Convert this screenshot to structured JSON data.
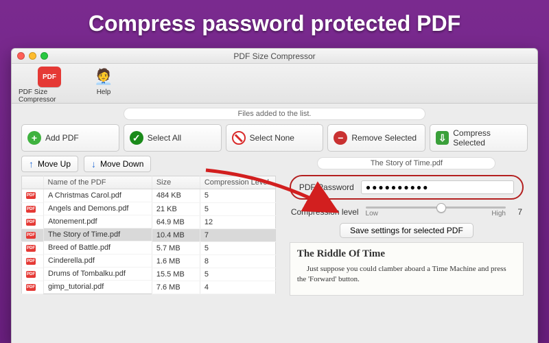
{
  "banner": "Compress password protected PDF",
  "window_title": "PDF Size Compressor",
  "toolbar": {
    "app_label": "PDF Size Compressor",
    "help_label": "Help",
    "badge": "PDF"
  },
  "status": "Files added to the list.",
  "actions": {
    "add": "Add PDF",
    "select_all": "Select All",
    "select_none": "Select None",
    "remove": "Remove Selected",
    "compress": "Compress Selected"
  },
  "move": {
    "up": "Move Up",
    "down": "Move Down"
  },
  "columns": {
    "name": "Name of the PDF",
    "size": "Size",
    "level": "Compression Level"
  },
  "files": [
    {
      "name": "A Christmas Carol.pdf",
      "size": "484 KB",
      "level": "5"
    },
    {
      "name": "Angels and Demons.pdf",
      "size": "21 KB",
      "level": "5"
    },
    {
      "name": "Atonement.pdf",
      "size": "64.9 MB",
      "level": "12"
    },
    {
      "name": "The Story of Time.pdf",
      "size": "10.4 MB",
      "level": "7",
      "selected": true
    },
    {
      "name": "Breed of Battle.pdf",
      "size": "5.7 MB",
      "level": "5"
    },
    {
      "name": "Cinderella.pdf",
      "size": "1.6 MB",
      "level": "8"
    },
    {
      "name": "Drums of Tombalku.pdf",
      "size": "15.5 MB",
      "level": "5"
    },
    {
      "name": "gimp_tutorial.pdf",
      "size": "7.6 MB",
      "level": "4"
    }
  ],
  "detail": {
    "filename": "The Story of Time.pdf",
    "password_label": "PDF Password",
    "password_value": "●●●●●●●●●●",
    "compression_label": "Compression level",
    "compression_value": "7",
    "low": "Low",
    "high": "High",
    "save": "Save settings for selected PDF"
  },
  "preview": {
    "title": "The Riddle Of Time",
    "body": "Just suppose you could clamber aboard a Time Machine and press the 'Forward' button."
  },
  "annotation": {
    "color": "#d21f1f"
  }
}
